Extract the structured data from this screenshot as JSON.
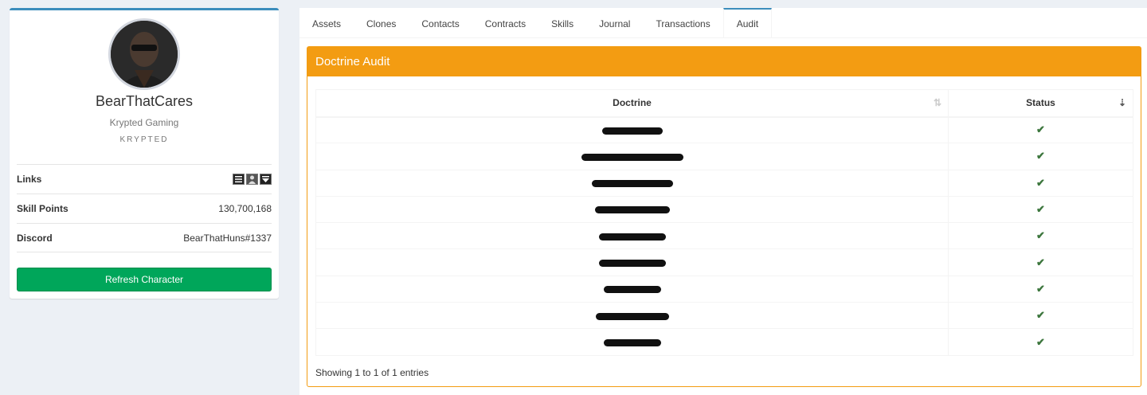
{
  "profile": {
    "name": "BearThatCares",
    "corporation": "Krypted Gaming",
    "ticker": "KRYPTED",
    "rows": [
      {
        "label": "Links",
        "value": ""
      },
      {
        "label": "Skill Points",
        "value": "130,700,168"
      },
      {
        "label": "Discord",
        "value": "BearThatHuns#1337"
      }
    ],
    "link_icons": [
      "list-icon",
      "portrait-icon",
      "chevron-down-icon"
    ],
    "refresh_label": "Refresh Character"
  },
  "tabs": [
    "Assets",
    "Clones",
    "Contacts",
    "Contracts",
    "Skills",
    "Journal",
    "Transactions",
    "Audit"
  ],
  "active_tab": "Audit",
  "audit": {
    "title": "Doctrine Audit",
    "columns": [
      "Doctrine",
      "Status"
    ],
    "rows": [
      {
        "doctrine_redacted": true,
        "status": "✔"
      },
      {
        "doctrine_redacted": true,
        "status": "✔"
      },
      {
        "doctrine_redacted": true,
        "status": "✔"
      },
      {
        "doctrine_redacted": true,
        "status": "✔"
      },
      {
        "doctrine_redacted": true,
        "status": "✔"
      },
      {
        "doctrine_redacted": true,
        "status": "✔"
      },
      {
        "doctrine_redacted": true,
        "status": "✔"
      },
      {
        "doctrine_redacted": true,
        "status": "✔"
      },
      {
        "doctrine_redacted": true,
        "status": "✔"
      }
    ],
    "footer": "Showing 1 to 1 of 1 entries"
  },
  "colors": {
    "accent": "#3c8dbc",
    "header": "#f39c12",
    "button": "#00a65a",
    "check": "#3c763d"
  }
}
